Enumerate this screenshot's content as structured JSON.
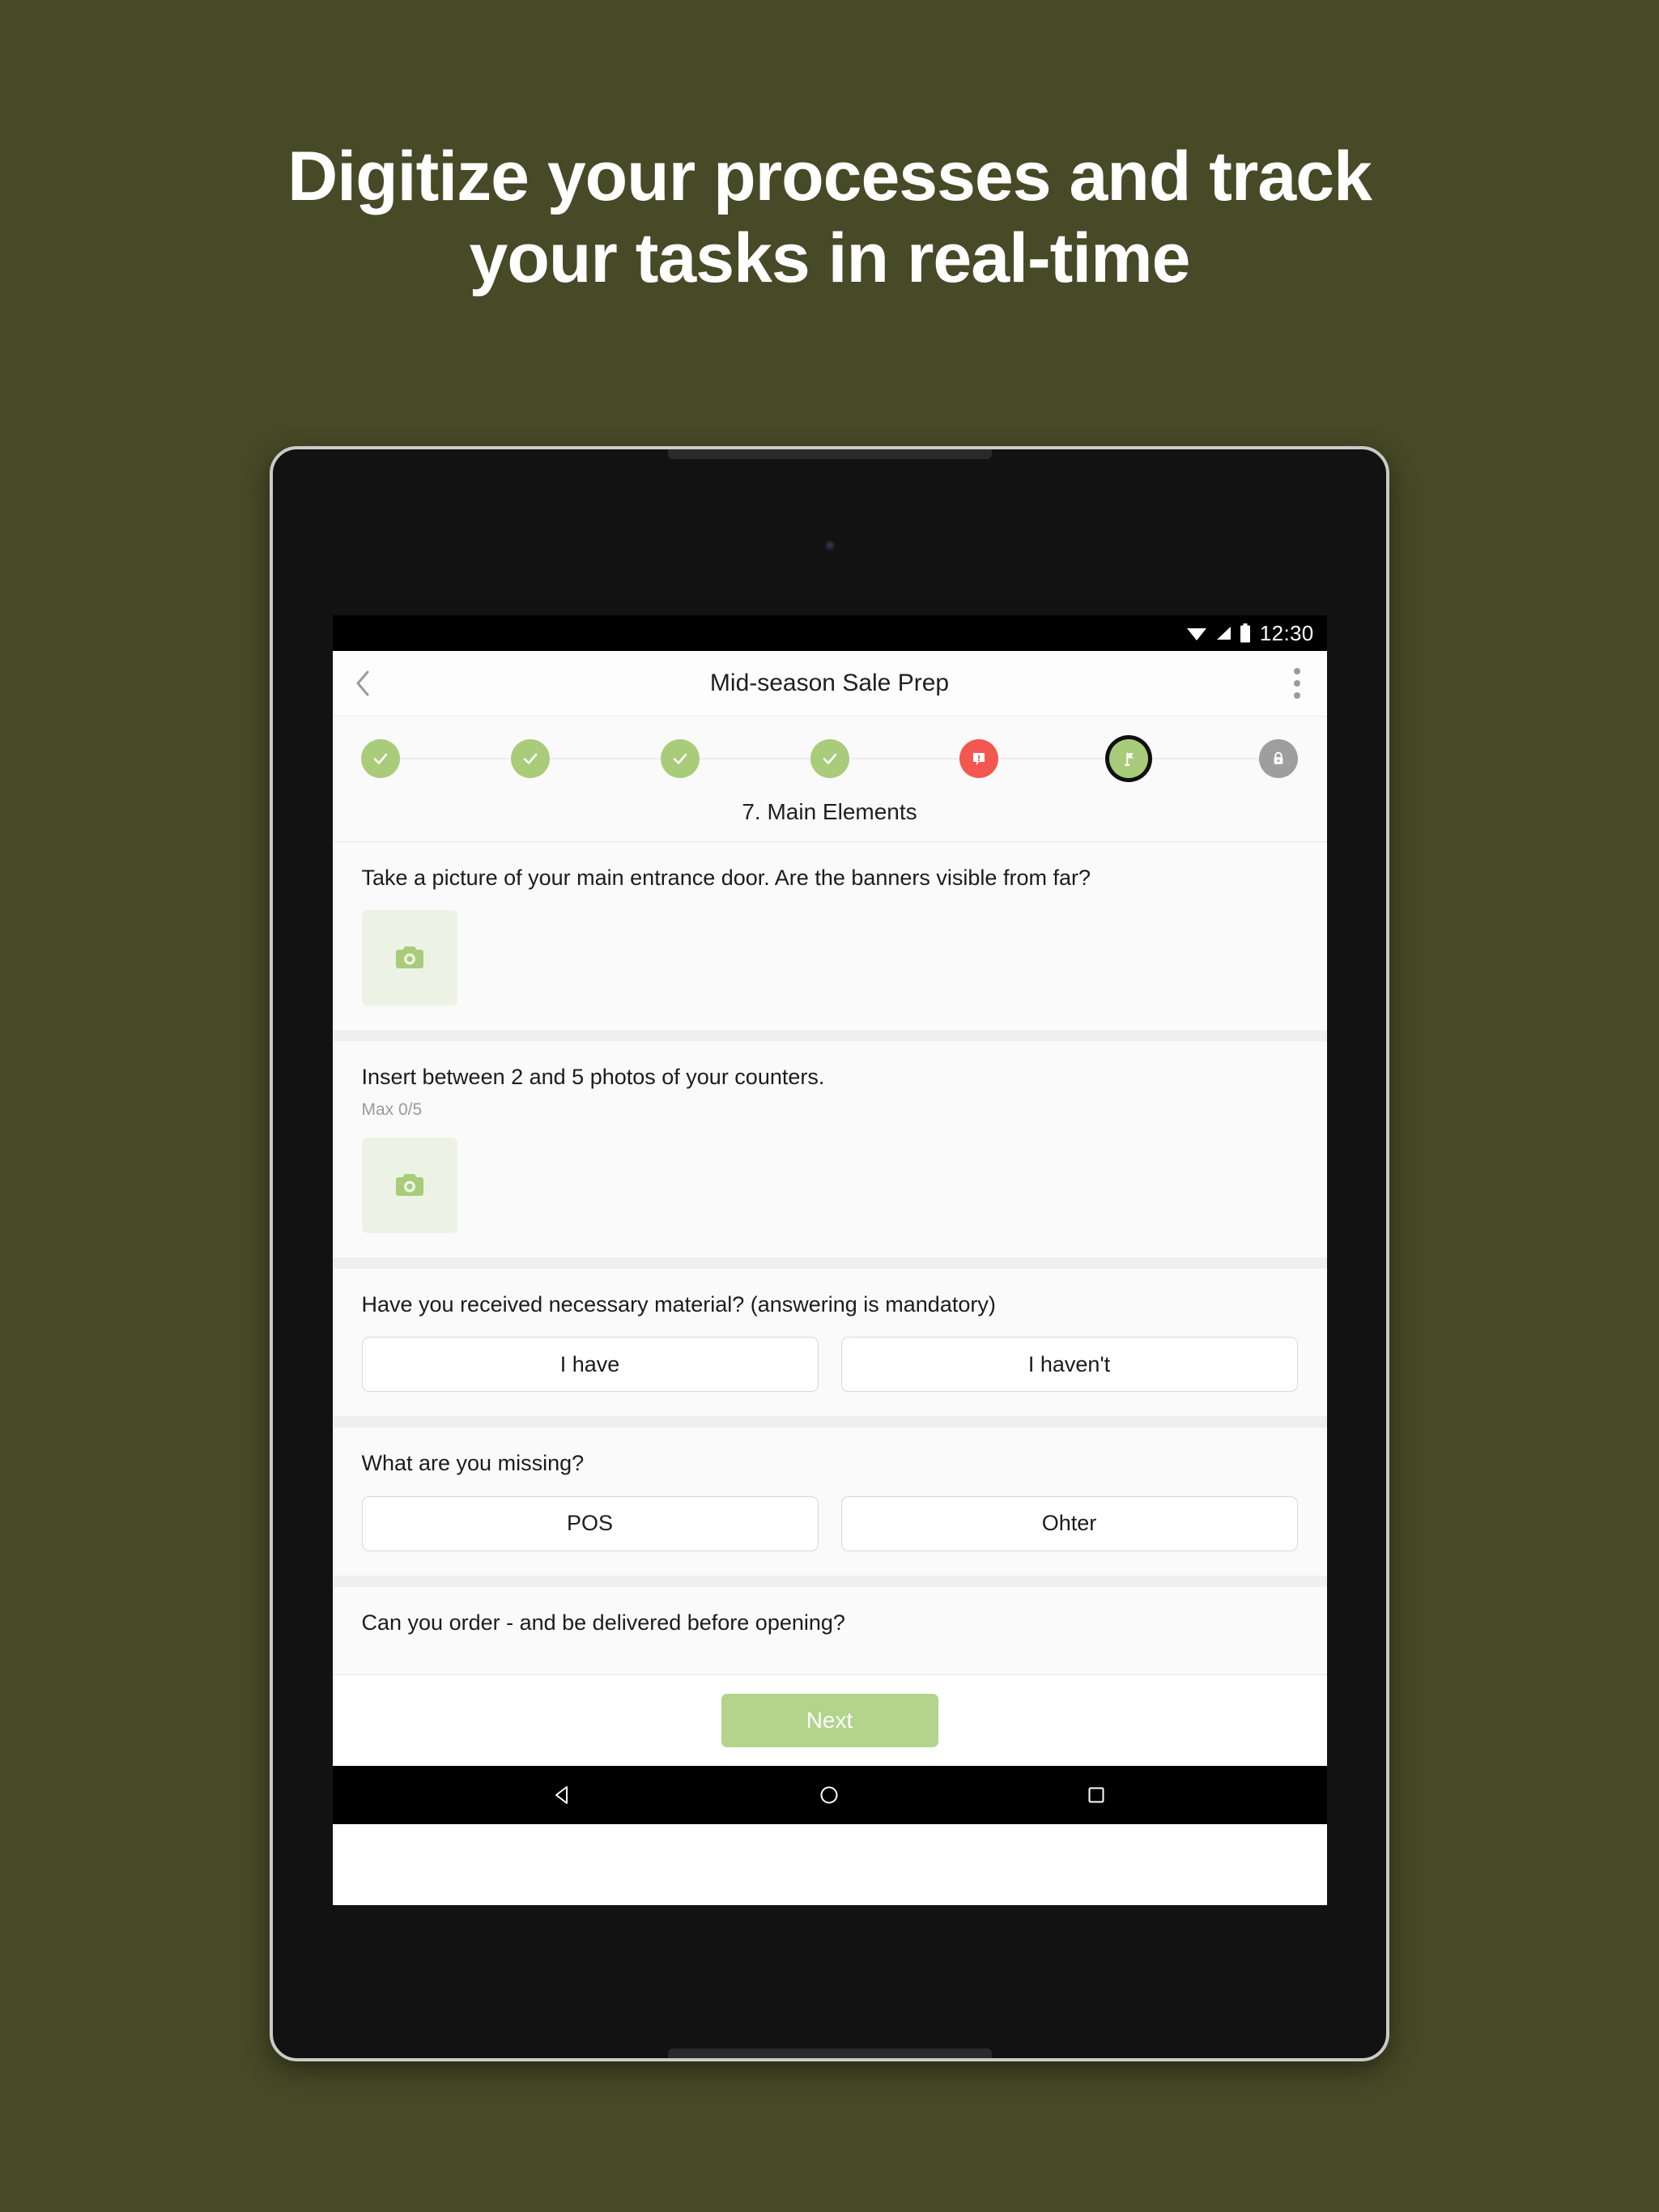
{
  "page": {
    "background_color": "#474a26",
    "headline_line1": "Digitize your processes and track",
    "headline_line2": "your tasks in real-time"
  },
  "status_bar": {
    "time": "12:30",
    "icons": [
      "wifi-icon",
      "cellular-signal-icon",
      "battery-icon"
    ]
  },
  "app_bar": {
    "title": "Mid-season Sale Prep",
    "back_icon": "chevron-left-icon",
    "overflow_icon": "overflow-menu-icon"
  },
  "stepper": {
    "current_label": "7. Main Elements",
    "accent_green": "#a8cc7a",
    "alert_red": "#f4574f",
    "locked_gray": "#9e9e9e",
    "steps": [
      {
        "index": 1,
        "state": "done",
        "icon": "check-icon"
      },
      {
        "index": 2,
        "state": "done",
        "icon": "check-icon"
      },
      {
        "index": 3,
        "state": "done",
        "icon": "check-icon"
      },
      {
        "index": 4,
        "state": "done",
        "icon": "check-icon"
      },
      {
        "index": 5,
        "state": "alert",
        "icon": "alert-comment-icon"
      },
      {
        "index": 6,
        "state": "current",
        "icon": "flag-icon"
      },
      {
        "index": 7,
        "state": "locked",
        "icon": "lock-icon"
      }
    ]
  },
  "questions": [
    {
      "id": "entrance-photo",
      "text": "Take a picture of your main entrance door. Are the banners visible from far?",
      "subtext": "",
      "input": "photo",
      "photo_icon": "camera-icon"
    },
    {
      "id": "counter-photos",
      "text": "Insert between 2 and 5 photos of your counters.",
      "subtext": "Max 0/5",
      "input": "photo",
      "photo_icon": "camera-icon"
    },
    {
      "id": "material-received",
      "text": "Have you received necessary material? (answering is mandatory)",
      "subtext": "",
      "input": "choice",
      "options": [
        "I have",
        "I haven't"
      ]
    },
    {
      "id": "what-missing",
      "text": "What are you missing?",
      "subtext": "",
      "input": "choice",
      "options": [
        "POS",
        "Ohter"
      ]
    },
    {
      "id": "order-delivery",
      "text": "Can you order - and be delivered before opening?",
      "subtext": "",
      "input": "none",
      "options": []
    }
  ],
  "footer": {
    "next_label": "Next"
  },
  "nav_bar": {
    "back_icon": "triangle-back-icon",
    "home_icon": "circle-home-icon",
    "recents_icon": "square-recents-icon"
  }
}
